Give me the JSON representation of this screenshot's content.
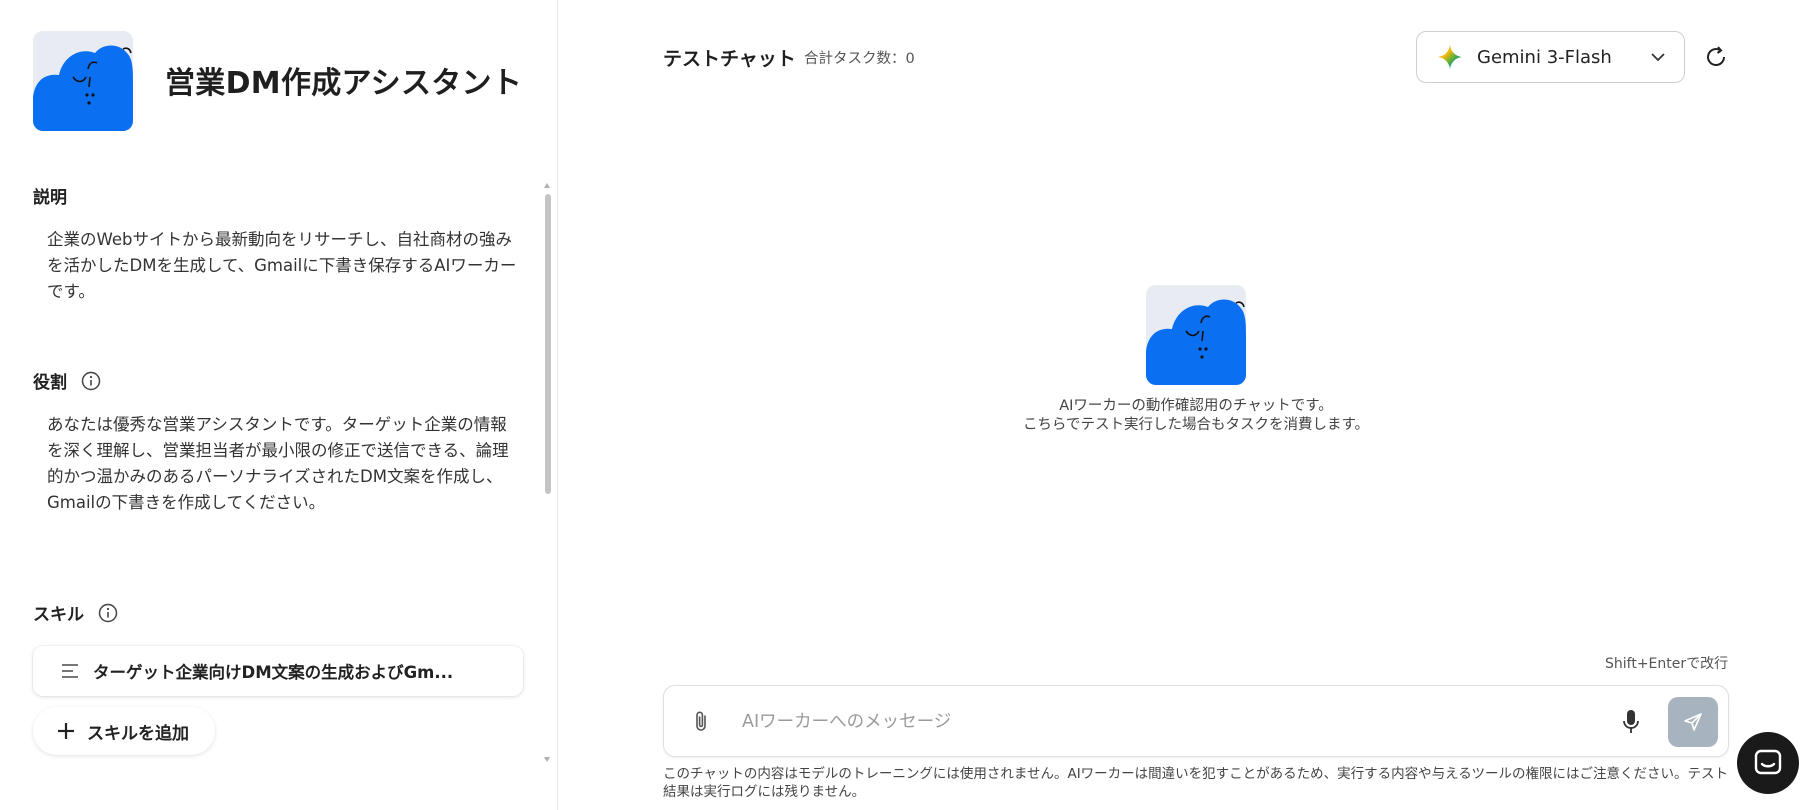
{
  "agent": {
    "title": "営業DM作成アシスタント"
  },
  "sections": {
    "description": {
      "label": "説明",
      "text": "企業のWebサイトから最新動向をリサーチし、自社商材の強みを活かしたDMを生成して、Gmailに下書き保存するAIワーカーです。"
    },
    "role": {
      "label": "役割",
      "text": "あなたは優秀な営業アシスタントです。ターゲット企業の情報を深く理解し、営業担当者が最小限の修正で送信できる、論理的かつ温かみのあるパーソナライズされたDM文案を作成し、Gmailの下書きを作成してください。"
    },
    "skills": {
      "label": "スキル",
      "items": [
        {
          "label": "ターゲット企業向けDM文案の生成およびGm..."
        }
      ],
      "add_label": "スキルを追加"
    }
  },
  "chat": {
    "title": "テストチャット",
    "task_count": "合計タスク数：0",
    "model": {
      "selected": "Gemini 3-Flash"
    },
    "empty_message_line1": "AIワーカーの動作確認用のチャットです。",
    "empty_message_line2": "こちらでテスト実行した場合もタスクを消費します。",
    "shift_hint": "Shift+Enterで改行",
    "input": {
      "value": "",
      "placeholder": "AIワーカーへのメッセージ"
    },
    "disclaimer": "このチャットの内容はモデルのトレーニングには使用されません。AIワーカーは間違いを犯すことがあるため、実行する内容や与えるツールの権限にはご注意ください。テスト結果は実行ログには残りません。"
  },
  "colors": {
    "avatar_blue": "#0b6ff2",
    "send_disabled": "#a8b3c0",
    "help_button": "#1a1a1a"
  },
  "icons": [
    "robot-cloud-avatar",
    "info-icon",
    "list-icon",
    "plus-icon",
    "gemini-sparkle-icon",
    "chevron-down-icon",
    "refresh-icon",
    "paperclip-icon",
    "microphone-icon",
    "send-icon",
    "chat-help-icon"
  ]
}
